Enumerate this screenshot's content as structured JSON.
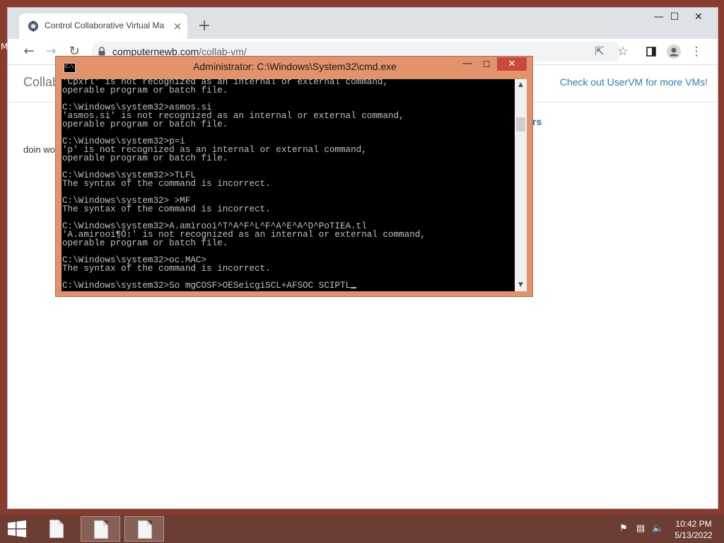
{
  "desktop": {
    "edge_letter": "M"
  },
  "browser": {
    "tab_title": "Control Collaborative Virtual Ma",
    "tab_close": "×",
    "new_tab": "+",
    "window_controls": {
      "minimize": "—",
      "maximize": "☐",
      "close": "✕"
    },
    "url_host": "computernewb.com",
    "url_path": "/collab-vm/",
    "page": {
      "brand": "Collab",
      "link": "Check out UserVM for more VMs!",
      "partial_heading": "rs",
      "partial_text": "doin wo"
    }
  },
  "cmd": {
    "title": "Administrator: C:\\Windows\\System32\\cmd.exe",
    "icon_text": "C:\\",
    "controls": {
      "minimize": "—",
      "maximize": "☐",
      "close": "✕"
    },
    "lines": [
      "'Cpxfl' is not recognized as an internal or external command,",
      "operable program or batch file.",
      "",
      "C:\\Windows\\system32>asmos.si",
      "'asmos.si' is not recognized as an internal or external command,",
      "operable program or batch file.",
      "",
      "C:\\Windows\\system32>p=i",
      "'p' is not recognized as an internal or external command,",
      "operable program or batch file.",
      "",
      "C:\\Windows\\system32>>TLFL",
      "The syntax of the command is incorrect.",
      "",
      "C:\\Windows\\system32> >MF",
      "The syntax of the command is incorrect.",
      "",
      "C:\\Windows\\system32>A.amirooi^T^A^F^L^F^A^E^A^D^PoTIEA.tl",
      "'A.amirooi¶Ô↕' is not recognized as an internal or external command,",
      "operable program or batch file.",
      "",
      "C:\\Windows\\system32>oc.MAC>",
      "The syntax of the command is incorrect.",
      "",
      "C:\\Windows\\system32>So mgCOSF>OESeicgiSCL+AFSOC SCIPTL"
    ]
  },
  "taskbar": {
    "clock_time": "10:42 PM",
    "clock_date": "5/13/2022"
  }
}
